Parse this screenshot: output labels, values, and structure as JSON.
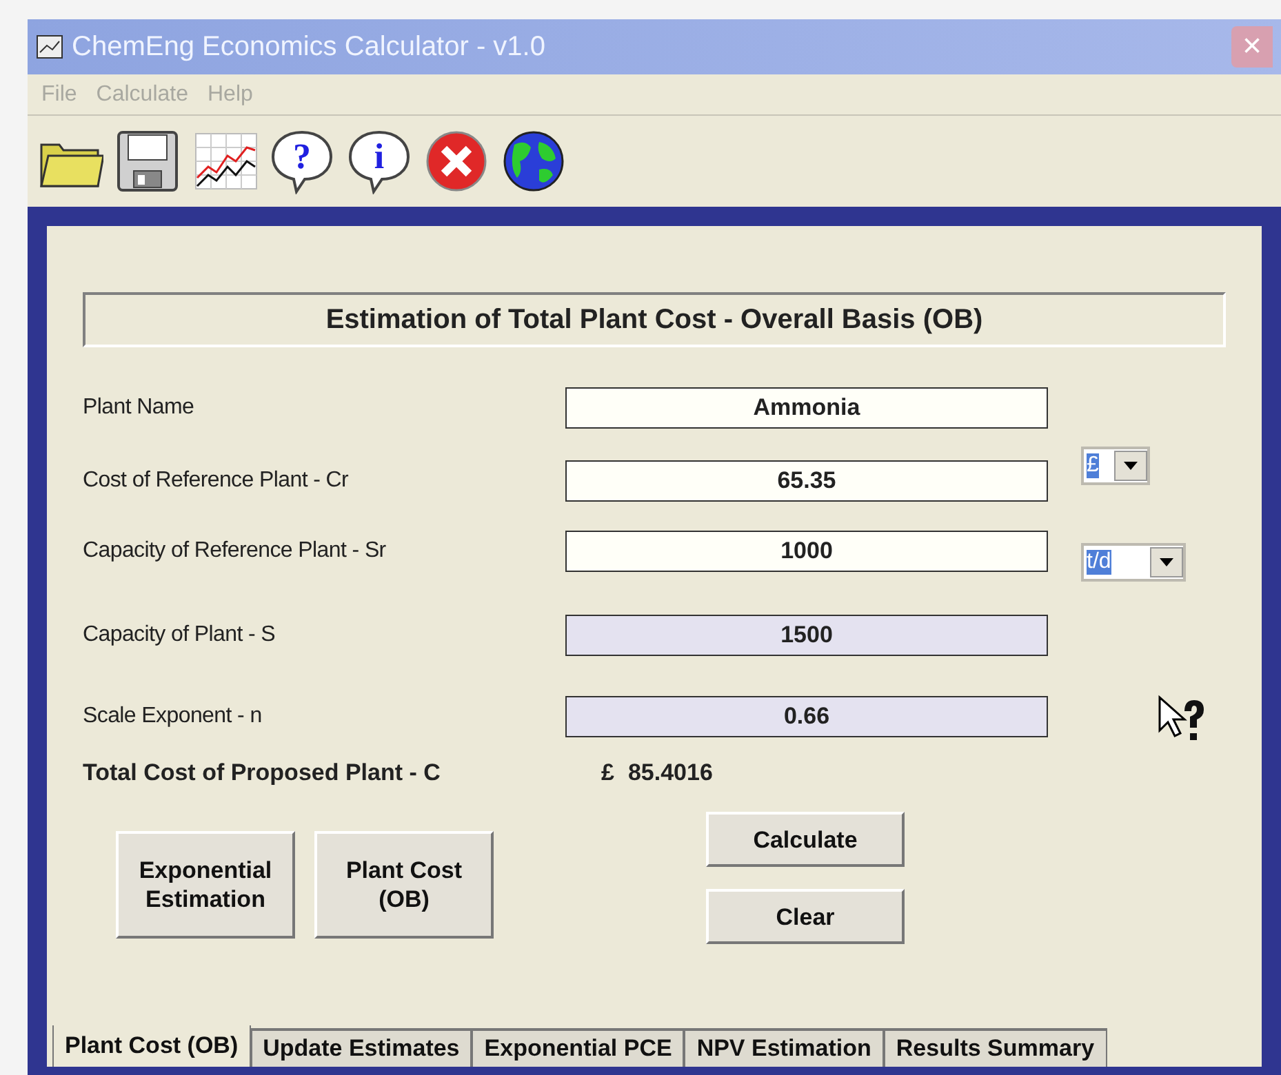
{
  "window": {
    "title": "ChemEng Economics Calculator - v1.0",
    "close": "×"
  },
  "menu": [
    {
      "label": "File",
      "disabled": true
    },
    {
      "label": "Calculate",
      "disabled": true
    },
    {
      "label": "Help",
      "disabled": true
    }
  ],
  "toolbar": [
    {
      "kind": "folder"
    },
    {
      "kind": "disk"
    },
    {
      "kind": "chart"
    },
    {
      "kind": "help",
      "glyph": "?"
    },
    {
      "kind": "info",
      "glyph": "i"
    },
    {
      "kind": "stop"
    },
    {
      "kind": "globe"
    }
  ],
  "heading": "Estimation of Total Plant Cost - Overall Basis (OB)",
  "fields": [
    {
      "label": "Plant Name",
      "value": "Ammonia",
      "shaded": false
    },
    {
      "label": "Cost of Reference Plant - Cr",
      "value": "65.35",
      "shaded": false
    },
    {
      "label": "Capacity of Reference Plant - Sr",
      "value": "1000",
      "shaded": false
    },
    {
      "label": "Capacity of Plant - S",
      "value": "1500",
      "shaded": true
    },
    {
      "label": "Scale Exponent - n",
      "value": "0.66",
      "shaded": true
    }
  ],
  "unit_selects": [
    {
      "value": "£"
    },
    {
      "value": "t/d"
    }
  ],
  "result": {
    "label": "Total Cost of Proposed Plant - C",
    "currency": "£",
    "value": "85.4016"
  },
  "side_buttons": [
    "Exponential Estimation",
    "Plant Cost (OB)"
  ],
  "action_buttons": [
    "Calculate",
    "Clear"
  ],
  "tabs": [
    {
      "label": "Plant Cost (OB)",
      "selected": true
    },
    {
      "label": "Update Estimates",
      "selected": false
    },
    {
      "label": "Exponential PCE",
      "selected": false
    },
    {
      "label": "NPV Estimation",
      "selected": false
    },
    {
      "label": "Results Summary",
      "selected": false
    }
  ]
}
